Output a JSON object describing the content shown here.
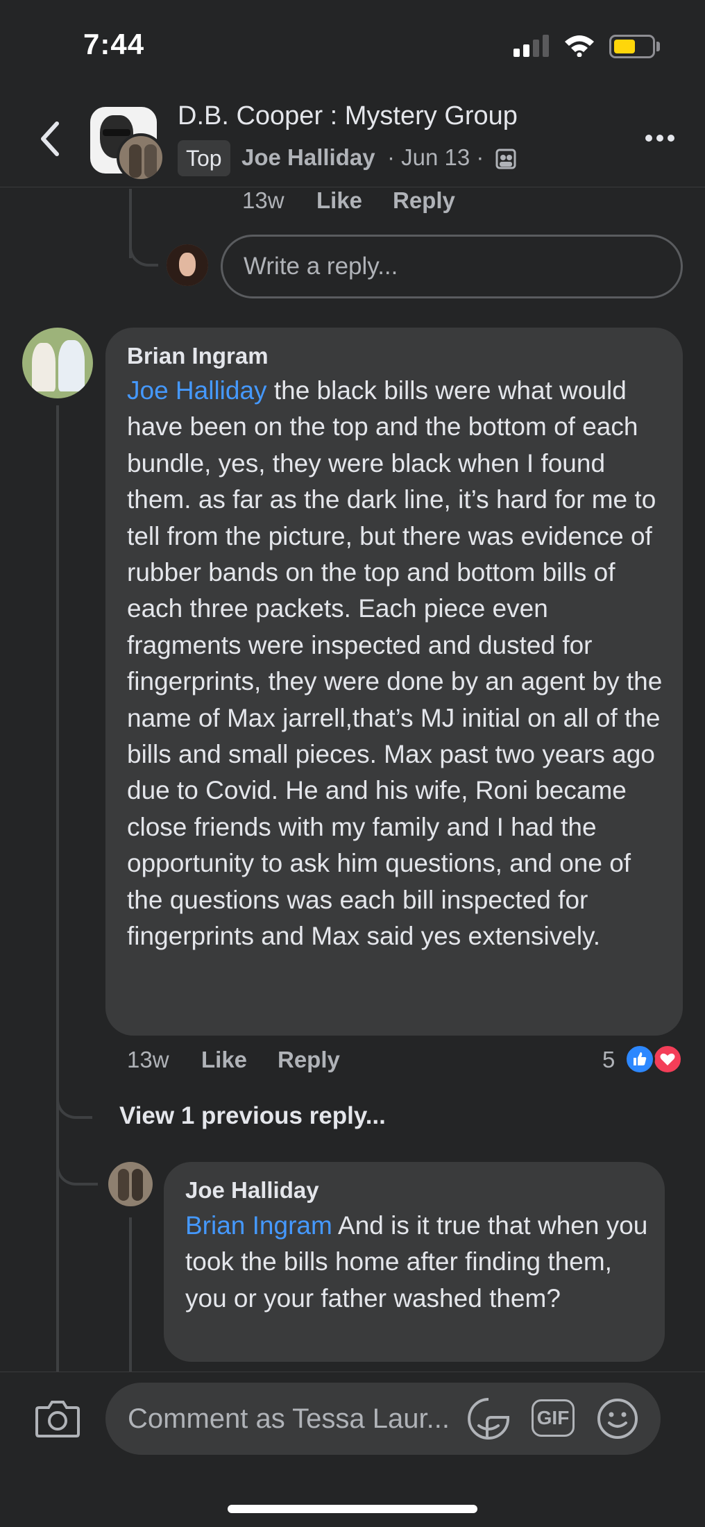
{
  "status_bar": {
    "time": "7:44"
  },
  "header": {
    "group_title": "D.B. Cooper : Mystery Group",
    "badge": "Top",
    "post_author": "Joe Halliday",
    "post_meta": "· Jun 13 ·"
  },
  "previous_comment_actions": {
    "time": "13w",
    "like": "Like",
    "reply": "Reply"
  },
  "reply_composer": {
    "placeholder": "Write a reply..."
  },
  "comments": [
    {
      "author": "Brian Ingram",
      "mention": "Joe Halliday",
      "text": " the black bills were what would have been on the top and the bottom of each bundle, yes, they were black when I found them. as far as the dark line, it’s hard for me to tell from the picture, but there was evidence of rubber bands on the top and bottom bills of each three packets. Each piece even fragments were inspected and dusted for fingerprints, they were done by an agent by the name of Max jarrell,that’s MJ initial on all of the bills and small pieces. Max past two years ago due to Covid. He and his wife, Roni became close friends with my family and I had the opportunity to ask him questions, and one of the questions was each bill  inspected for  fingerprints and Max said yes extensively.",
      "time": "13w",
      "like": "Like",
      "reply": "Reply",
      "reaction_count": "5",
      "reactions": [
        "like",
        "love"
      ]
    }
  ],
  "view_previous": "View 1 previous reply...",
  "reply": {
    "author": "Joe Halliday",
    "mention": "Brian Ingram",
    "text": "  And is it true that when you took the bills home after finding them, you or your father washed them?"
  },
  "bottom_composer": {
    "placeholder": "Comment as Tessa Laur...",
    "gif_label": "GIF"
  },
  "colors": {
    "background": "#242526",
    "bubble": "#3a3b3c",
    "mention": "#4599ff",
    "like": "#2d88ff",
    "love": "#f33e58",
    "battery": "#ffd60a"
  }
}
